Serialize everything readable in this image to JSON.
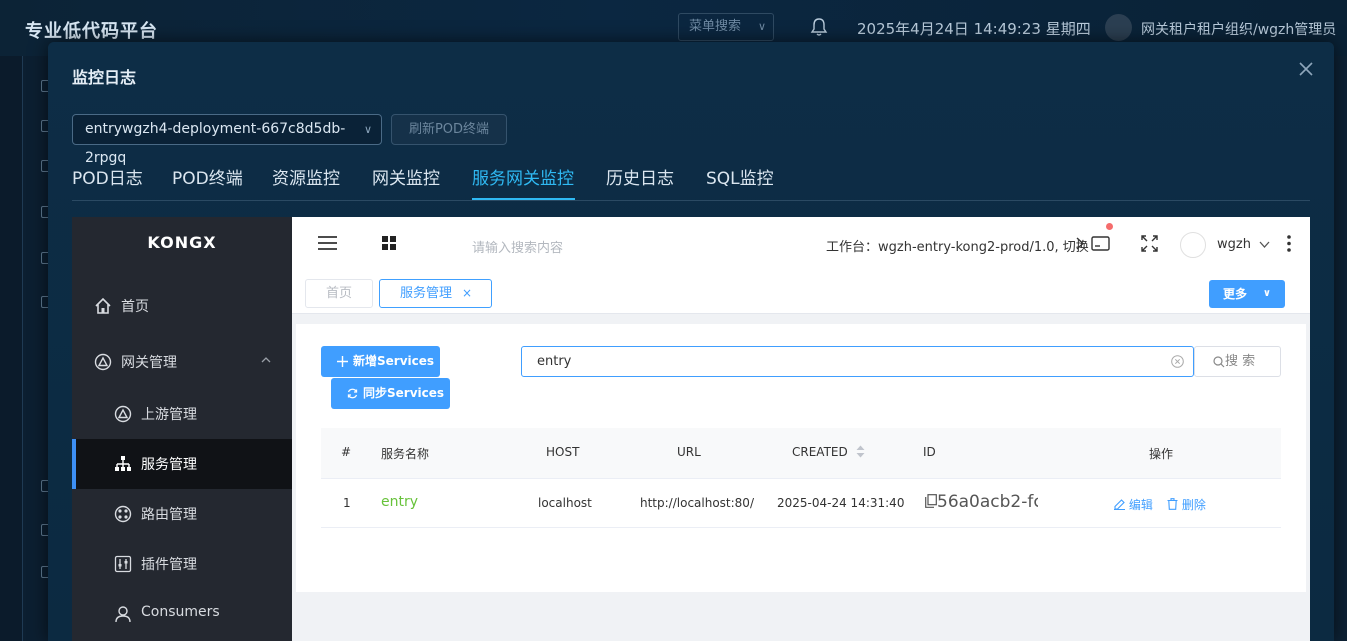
{
  "app": {
    "title": "专业低代码平台",
    "menu_search_placeholder": "菜单搜索",
    "datetime": "2025年4月24日 14:49:23 星期四",
    "user": "网关租户租户组织/wgzh管理员"
  },
  "modal": {
    "title": "监控日志",
    "pod_select_value": "entrywgzh4-deployment-667c8d5db-2rpgq",
    "refresh_label": "刷新POD终端",
    "tabs": [
      {
        "label": "POD日志"
      },
      {
        "label": "POD终端"
      },
      {
        "label": "资源监控"
      },
      {
        "label": "网关监控"
      },
      {
        "label": "服务网关监控"
      },
      {
        "label": "历史日志"
      },
      {
        "label": "SQL监控"
      }
    ],
    "active_tab": "服务网关监控"
  },
  "kong": {
    "logo": "KONGX",
    "nav": [
      {
        "label": "首页"
      },
      {
        "label": "网关管理"
      },
      {
        "label": "上游管理"
      },
      {
        "label": "服务管理"
      },
      {
        "label": "路由管理"
      },
      {
        "label": "插件管理"
      },
      {
        "label": "Consumers"
      }
    ],
    "header": {
      "search_placeholder": "请输入搜索内容",
      "workspace": "工作台：wgzh-entry-kong2-prod/1.0, 切换",
      "user": "wgzh"
    },
    "tags": {
      "home": "首页",
      "current": "服务管理",
      "close": "×",
      "more": "更多"
    },
    "toolbar": {
      "add_label": "新增Services",
      "sync_label": "同步Services",
      "search_value": "entry",
      "search_btn": "搜 索"
    },
    "table": {
      "headers": [
        "#",
        "服务名称",
        "HOST",
        "URL",
        "CREATED",
        "ID",
        "操作"
      ],
      "rows": [
        {
          "index": "1",
          "name": "entry",
          "host": "localhost",
          "url": "http://localhost:80/",
          "created": "2025-04-24 14:31:40",
          "id": "56a0acb2-fc",
          "edit": "编辑",
          "delete": "删除"
        }
      ]
    }
  },
  "colors": {
    "accent": "#2fb9f3",
    "primary": "#409eff",
    "success": "#67c23a",
    "sidebar": "#242830"
  }
}
